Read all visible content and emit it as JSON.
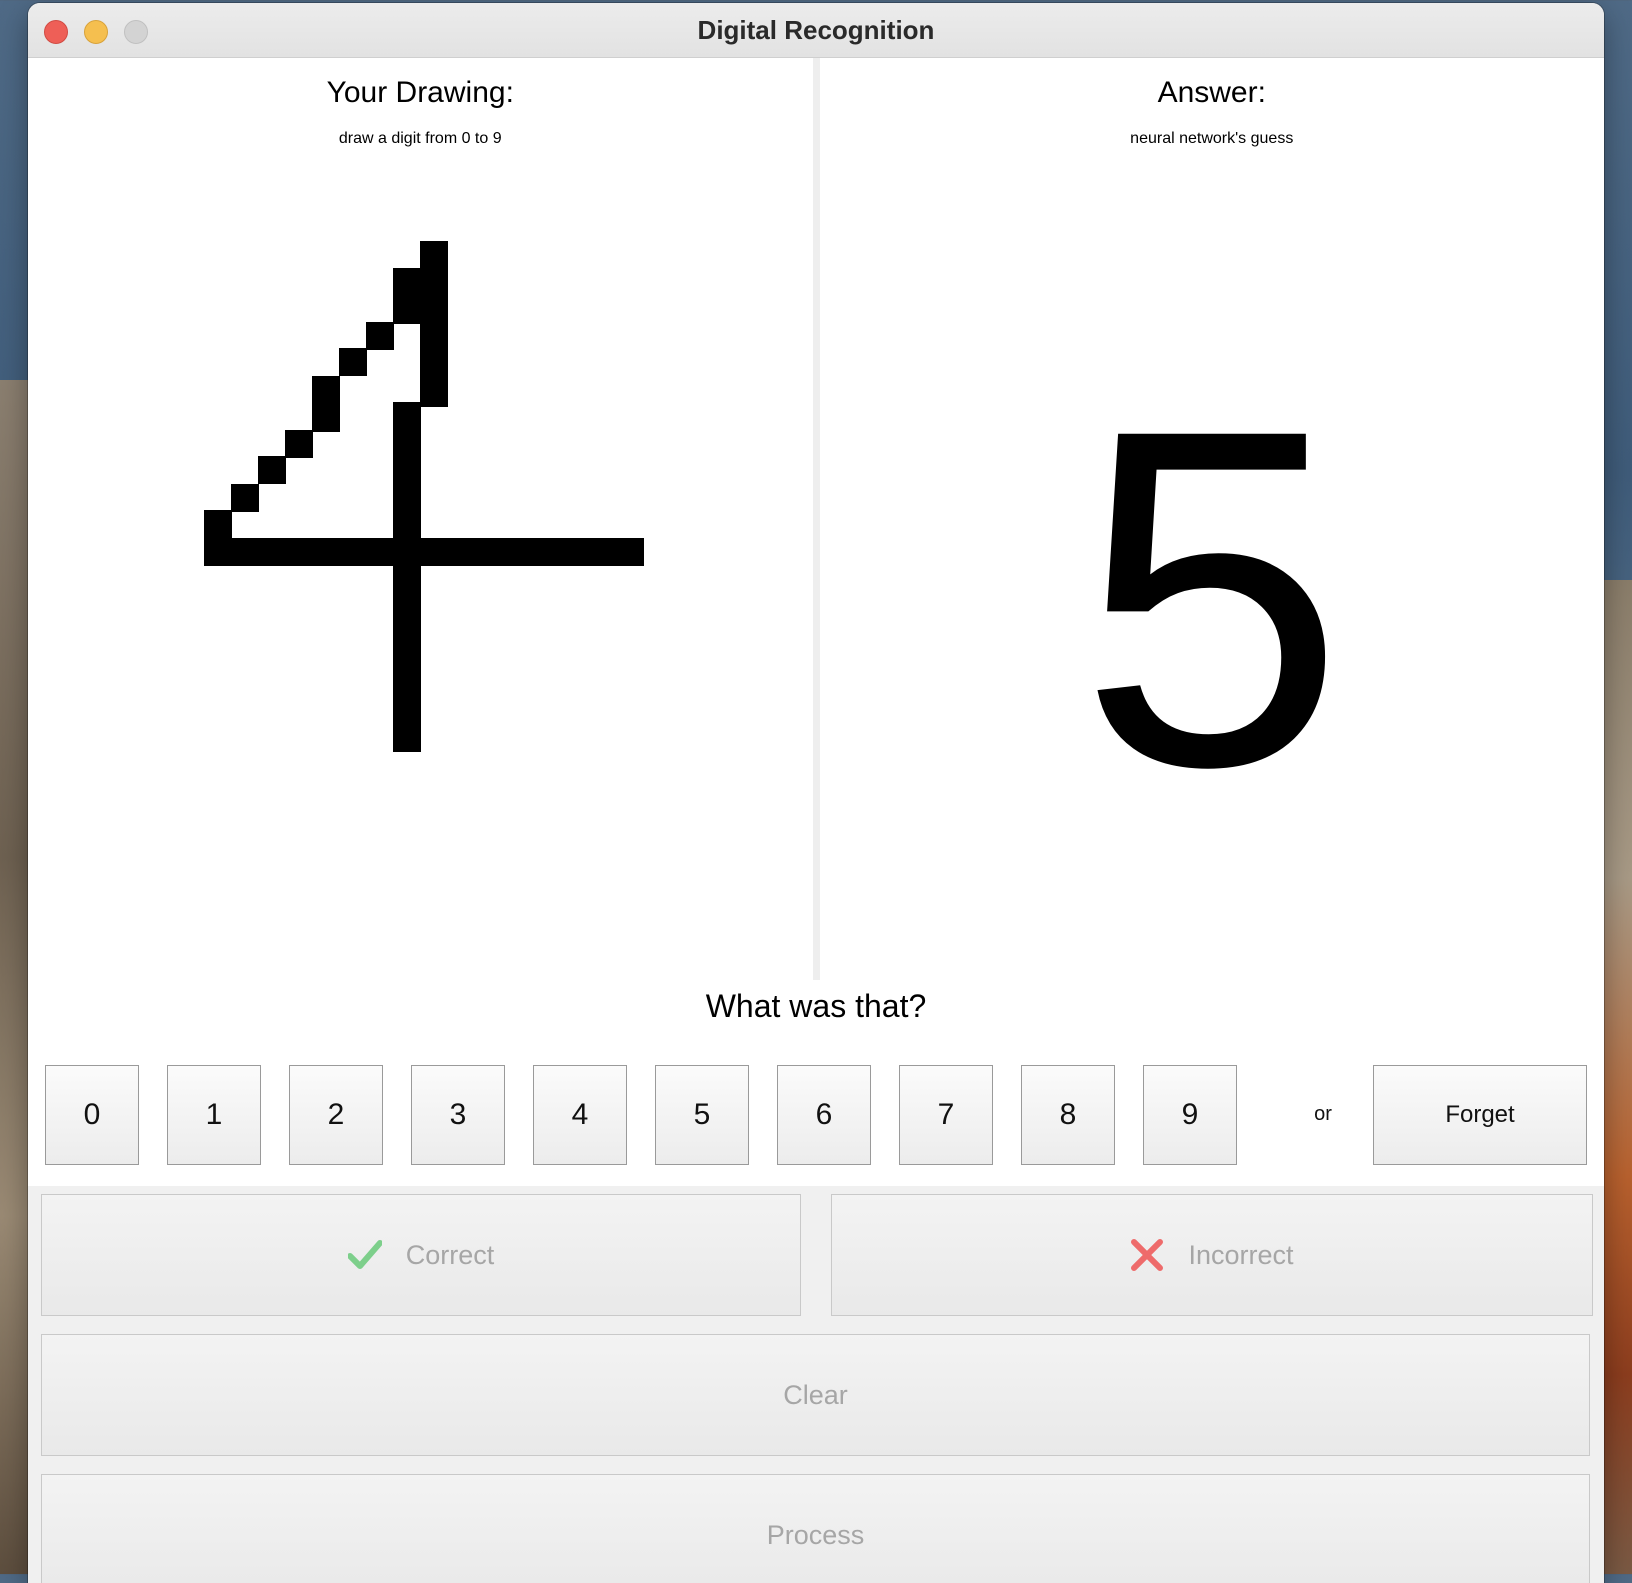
{
  "window": {
    "title": "Digital Recognition"
  },
  "drawing_panel": {
    "heading": "Your Drawing:",
    "subtitle": "draw a digit from 0 to 9"
  },
  "answer_panel": {
    "heading": "Answer:",
    "subtitle": "neural network's guess",
    "digit": "5"
  },
  "feedback": {
    "question": "What was that?",
    "digits": [
      "0",
      "1",
      "2",
      "3",
      "4",
      "5",
      "6",
      "7",
      "8",
      "9"
    ],
    "or_label": "or",
    "forget_label": "Forget"
  },
  "actions": {
    "correct_label": "Correct",
    "incorrect_label": "Incorrect",
    "clear_label": "Clear",
    "process_label": "Process"
  },
  "colors": {
    "correct_icon": "#7dcf8b",
    "incorrect_icon": "#ee6b6b",
    "disabled_text": "#a6a6a6"
  }
}
